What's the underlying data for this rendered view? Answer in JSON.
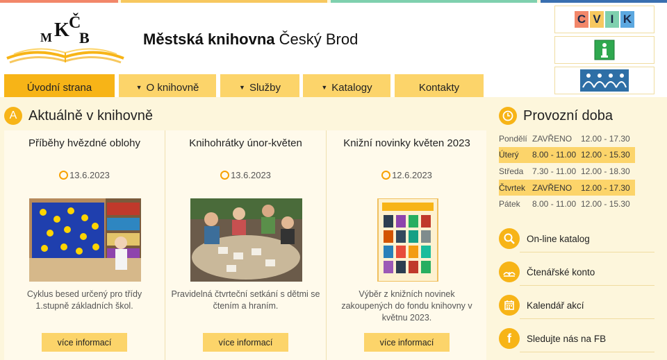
{
  "header": {
    "title_bold": "Městská knihovna",
    "title_rest": " Český Brod",
    "logo_letters": "MKČB"
  },
  "nav": {
    "items": [
      {
        "label": "Úvodní strana",
        "dropdown": false,
        "active": true
      },
      {
        "label": "O knihovně",
        "dropdown": true,
        "active": false
      },
      {
        "label": "Služby",
        "dropdown": true,
        "active": false
      },
      {
        "label": "Katalogy",
        "dropdown": true,
        "active": false
      },
      {
        "label": "Kontakty",
        "dropdown": false,
        "active": false
      }
    ]
  },
  "widgets": {
    "cvik_letters": [
      "C",
      "V",
      "I",
      "K"
    ],
    "cvik_colors": [
      "#f2876a",
      "#f7c85f",
      "#7fd0ae",
      "#5ca8e0"
    ]
  },
  "news": {
    "section_letter": "A",
    "section_title": "Aktuálně v knihovně",
    "items": [
      {
        "title": "Příběhy hvězdné oblohy",
        "date": "13.6.2023",
        "desc": "Cyklus besed určený pro třídy 1.stupně základních škol.",
        "more": "více informací",
        "image": "photo-stars-flag"
      },
      {
        "title": "Knihohrátky únor-květen",
        "date": "13.6.2023",
        "desc": "Pravidelná čtvrteční setkání s dětmi se čtením a hraním.",
        "more": "více informací",
        "image": "photo-children-table"
      },
      {
        "title": "Knižní novinky květen 2023",
        "date": "12.6.2023",
        "desc": "Výběr z knižních novinek zakoupených do fondu knihovny v květnu 2023.",
        "more": "více informací",
        "image": "poster-book-covers"
      }
    ]
  },
  "hours": {
    "title": "Provozní doba",
    "rows": [
      {
        "day": "Pondělí",
        "a": "ZAVŘENO",
        "b": "12.00 - 17.30",
        "highlight": false
      },
      {
        "day": "Úterý",
        "a": "8.00 - 11.00",
        "b": "12.00 - 15.30",
        "highlight": true
      },
      {
        "day": "Středa",
        "a": "7.30 - 11.00",
        "b": "12.00 - 18.30",
        "highlight": false
      },
      {
        "day": "Čtvrtek",
        "a": "ZAVŘENO",
        "b": "12.00 - 17.30",
        "highlight": true
      },
      {
        "day": "Pátek",
        "a": "8.00 - 11.00",
        "b": "12.00 - 15.30",
        "highlight": false
      }
    ]
  },
  "links": [
    {
      "label": "On-line katalog",
      "icon": "search-icon"
    },
    {
      "label": "Čtenářské konto",
      "icon": "book-icon"
    },
    {
      "label": "Kalendář akcí",
      "icon": "calendar-icon"
    },
    {
      "label": "Sledujte nás na FB",
      "icon": "facebook-icon"
    }
  ],
  "colors": {
    "accent": "#f7b417",
    "nav": "#fcd46a",
    "bg": "#fdf6dc"
  }
}
